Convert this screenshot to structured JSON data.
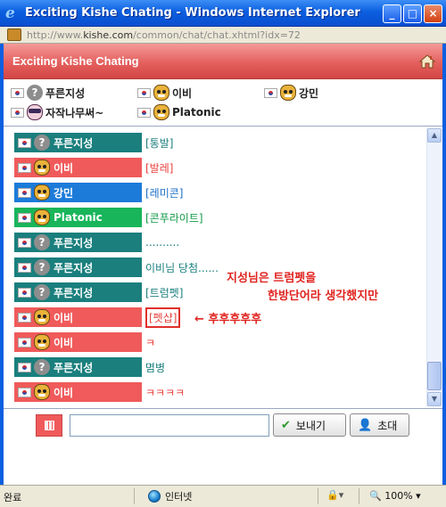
{
  "browser": {
    "title": "Exciting Kishe Chating - Windows Internet Explorer",
    "url_prefix": "http://www.",
    "url_domain": "kishe.com",
    "url_path": "/common/chat/chat.xhtml?idx=72"
  },
  "app": {
    "title": "Exciting Kishe Chating"
  },
  "users": [
    {
      "name": "푸른지성",
      "avatar": "question-avatar-icon"
    },
    {
      "name": "이비",
      "avatar": "cat-avatar-icon"
    },
    {
      "name": "강민",
      "avatar": "cat-avatar-icon"
    },
    {
      "name": "자작나무써~",
      "avatar": "mask-avatar-icon"
    },
    {
      "name": "Platonic",
      "avatar": "cat-avatar-icon"
    }
  ],
  "messages": [
    {
      "sender": "푸른지성",
      "text": "[통발]",
      "color": "teal"
    },
    {
      "sender": "이비",
      "text": "[발레]",
      "color": "red"
    },
    {
      "sender": "강민",
      "text": "[레미콘]",
      "color": "blue"
    },
    {
      "sender": "Platonic",
      "text": "[콘푸라이트]",
      "color": "green"
    },
    {
      "sender": "푸른지성",
      "text": "..........",
      "color": "teal"
    },
    {
      "sender": "푸른지성",
      "text": "이비님 당첨......",
      "color": "teal"
    },
    {
      "sender": "푸른지성",
      "text": "[트럼펫]",
      "color": "teal"
    },
    {
      "sender": "이비",
      "text": "[펫샵]",
      "color": "red"
    },
    {
      "sender": "이비",
      "text": "ㅋ",
      "color": "red"
    },
    {
      "sender": "푸른지성",
      "text": "몀병",
      "color": "teal"
    },
    {
      "sender": "이비",
      "text": "ㅋㅋㅋㅋ",
      "color": "red"
    }
  ],
  "annotations": {
    "line1": "지성님은 트럼펫을",
    "line2": "한방단어라 생각했지만",
    "line3": "← 후후후후후"
  },
  "input": {
    "placeholder": "",
    "value": ""
  },
  "buttons": {
    "send": "보내기",
    "invite": "초대"
  },
  "status": {
    "left": "완료",
    "zone": "인터넷",
    "zoom": "100%"
  },
  "colors": {
    "teal": "#1a7f7d",
    "red": "#f05a5a",
    "blue": "#1c7bd9",
    "green": "#18b55a",
    "header": "#e4605e"
  }
}
